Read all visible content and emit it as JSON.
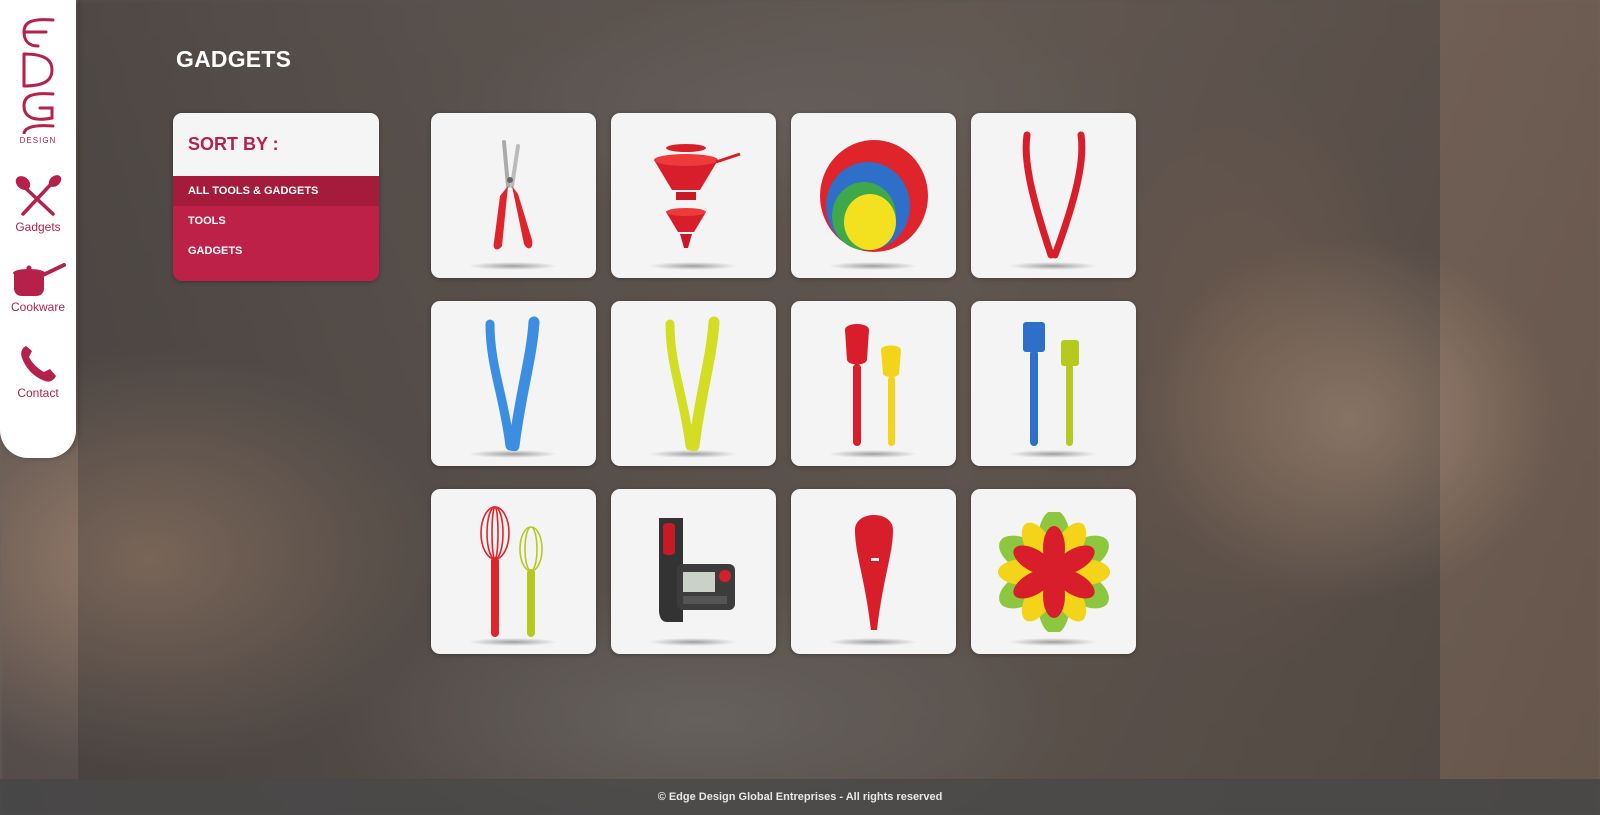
{
  "nav": {
    "logo_text": "EDGE",
    "logo_sub": "DESIGN",
    "items": [
      {
        "label": "Gadgets",
        "icon": "whisk-spatula-icon"
      },
      {
        "label": "Cookware",
        "icon": "saucepan-icon"
      },
      {
        "label": "Contact",
        "icon": "phone-icon"
      }
    ]
  },
  "page": {
    "title": "GADGETS"
  },
  "sort": {
    "heading": "SORT BY :",
    "options": [
      "ALL TOOLS & GADGETS",
      "TOOLS",
      "GADGETS"
    ],
    "selected": "ALL TOOLS & GADGETS"
  },
  "products": [
    {
      "icon": "kitchen-shears-icon"
    },
    {
      "icon": "collapsible-funnel-icon"
    },
    {
      "icon": "lid-set-icon"
    },
    {
      "icon": "red-tongs-icon"
    },
    {
      "icon": "blue-tongs-icon"
    },
    {
      "icon": "yellow-tongs-icon"
    },
    {
      "icon": "spatula-pair-icon"
    },
    {
      "icon": "brush-pair-icon"
    },
    {
      "icon": "whisk-pair-icon"
    },
    {
      "icon": "timer-clip-icon"
    },
    {
      "icon": "slotted-spoon-icon"
    },
    {
      "icon": "flower-trivet-icon"
    }
  ],
  "footer": {
    "text": "© Edge Design Global Entreprises - All rights reserved"
  },
  "colors": {
    "brand": "#be2148",
    "brand_dark": "#a51b3c",
    "card_bg": "#f4f4f4"
  }
}
